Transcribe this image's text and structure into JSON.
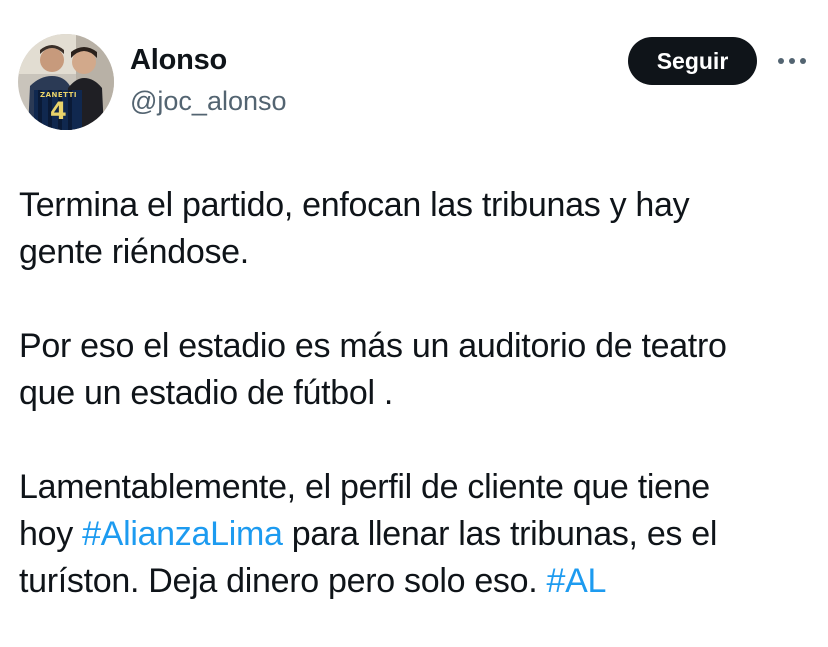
{
  "author": {
    "name": "Alonso",
    "handle": "@joc_alonso",
    "avatar_icon": "profile-photo-icon",
    "avatar_jersey_text": "ZANETTI",
    "avatar_jersey_number": "4"
  },
  "actions": {
    "follow_label": "Seguir",
    "more_icon": "more-options-icon"
  },
  "tweet": {
    "paragraph_1": "Termina el partido, enfocan las tribunas y hay\ngente riéndose.",
    "paragraph_2": "Por eso el estadio es más un auditorio de teatro\nque un estadio  de fútbol .",
    "paragraph_3": {
      "part_1": "Lamentablemente, el perfil de cliente que tiene\nhoy ",
      "hashtag_1": "#AlianzaLima",
      "part_2": " para llenar las tribunas, es el\nturíston. Deja dinero pero solo eso. ",
      "hashtag_2": "#AL"
    }
  },
  "colors": {
    "text": "#0f1419",
    "secondary_text": "#536471",
    "hashtag": "#1d9bf0",
    "follow_button_bg": "#0f1419",
    "follow_button_text": "#ffffff"
  }
}
